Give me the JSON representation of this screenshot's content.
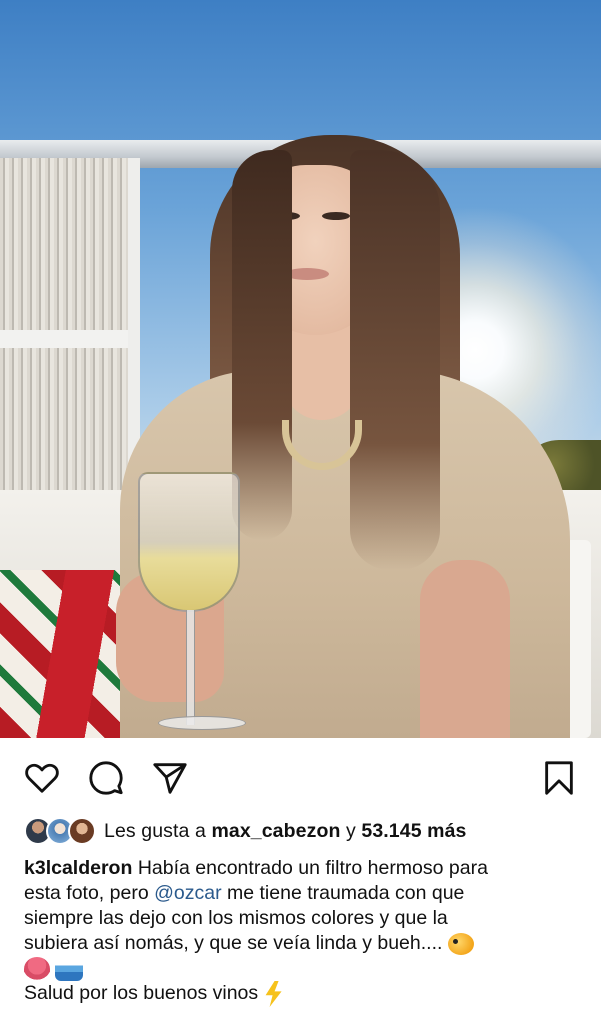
{
  "post": {
    "likes": {
      "prefix": "Les gusta a",
      "liker": "max_cabezon",
      "connector": "y",
      "count": "53.145 más"
    },
    "caption": {
      "username": "k3lcalderon",
      "line1_text": "Había encontrado un filtro hermoso para",
      "line2_before": "esta foto, pero",
      "mention": "@ozcar",
      "line2_after": "me tiene traumada con que",
      "line3": "siempre las dejo con los mismos colores y que la",
      "line4": "subiera así nomás, y que se veía linda y bueh....",
      "line6": "Salud por los buenos vinos"
    },
    "icons": {
      "like": "heart-icon",
      "comment": "comment-bubble-icon",
      "share": "paper-plane-icon",
      "save": "bookmark-icon",
      "caption_emojis": [
        "blowfish-emoji",
        "octopus-emoji",
        "water-wave-emoji",
        "lightning-emoji"
      ]
    }
  }
}
